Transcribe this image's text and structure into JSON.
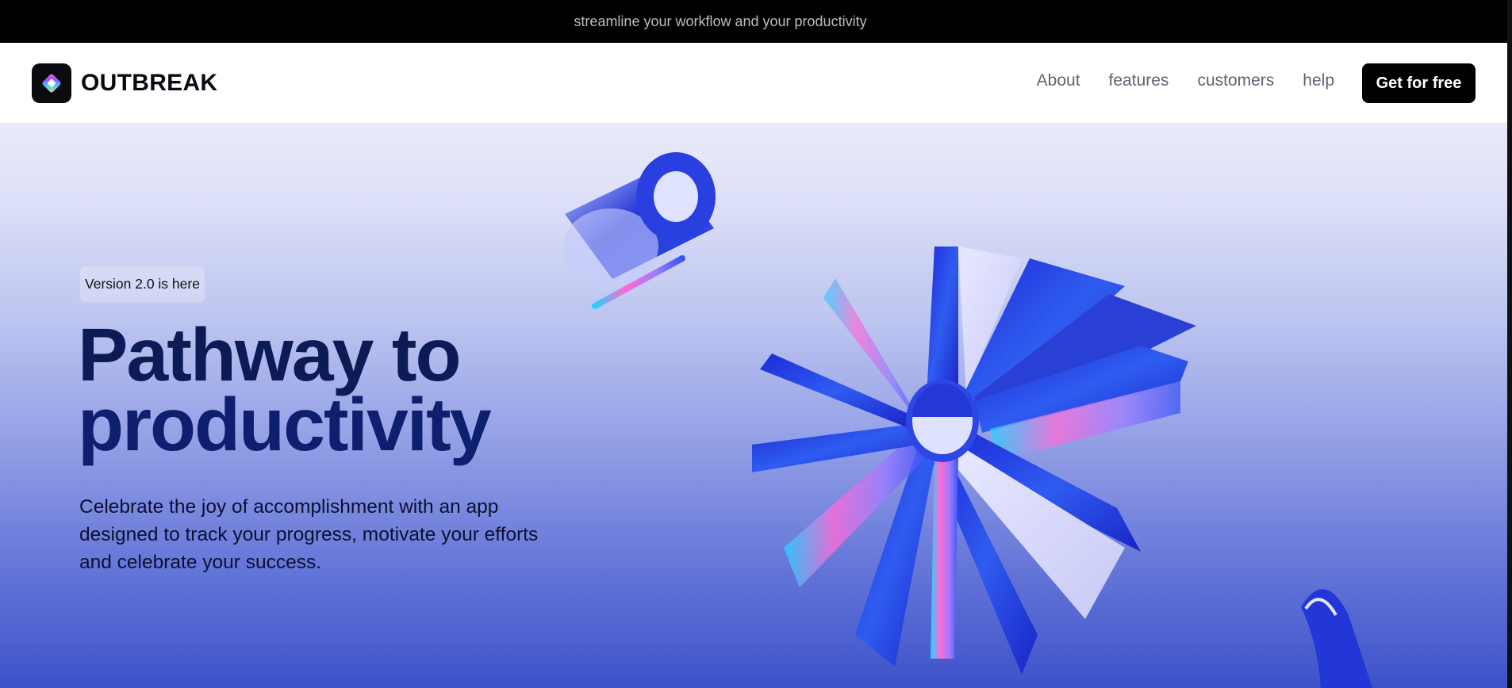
{
  "announcement": {
    "text": "streamline your workflow and your productivity"
  },
  "navbar": {
    "brand": "OUTBREAK",
    "links": [
      {
        "label": "About"
      },
      {
        "label": "features"
      },
      {
        "label": "customers"
      },
      {
        "label": "help"
      }
    ],
    "cta_label": "Get for free"
  },
  "hero": {
    "badge": "Version 2.0 is here",
    "headline_line1": "Pathway to",
    "headline_line2": "productivity",
    "subtext": "Celebrate the joy of accomplishment with an app designed to track your progress, motivate your efforts and celebrate your success."
  },
  "colors": {
    "announcement_bg": "#000000",
    "cta_bg": "#000000",
    "headline": "#0c1a55",
    "hero_gradient_top": "#e9ebfb",
    "hero_gradient_bottom": "#3d52c9",
    "art_primary": "#1a2fd6"
  },
  "icons": {
    "logo": "outbreak-diamond-logo-icon"
  }
}
